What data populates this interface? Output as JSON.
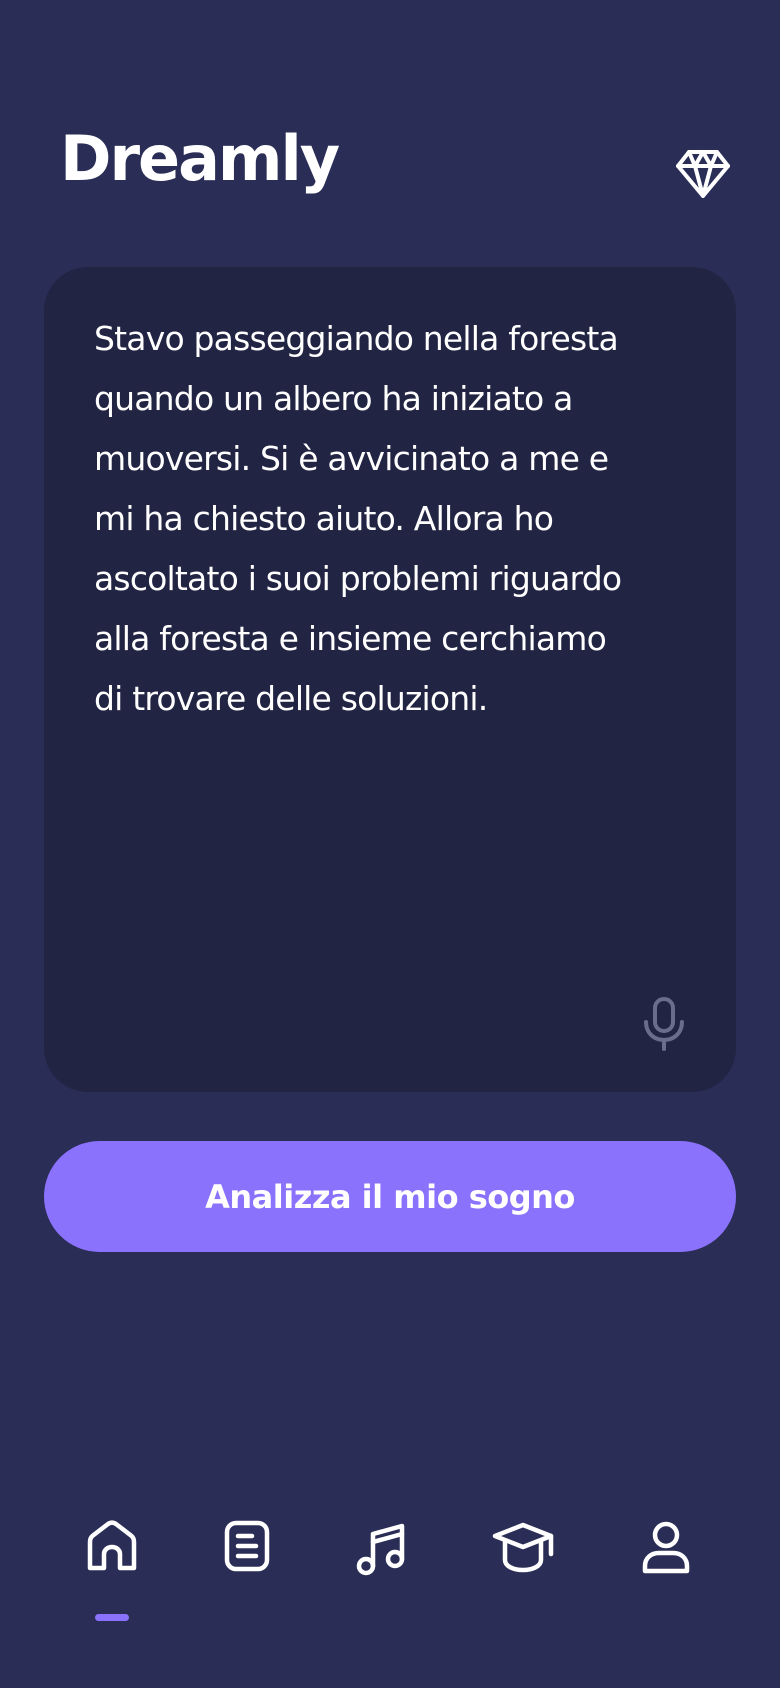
{
  "header": {
    "title": "Dreamly",
    "premium_icon": "diamond-icon"
  },
  "dream_input": {
    "text": "Stavo passeggiando nella foresta\nquando un albero ha iniziato a\nmuoversi. Si è avvicinato a me e\nmi ha chiesto aiuto. Allora ho\nascoltato i suoi problemi riguardo\nalla foresta e insieme cerchiamo\ndi trovare delle soluzioni.",
    "mic_icon": "microphone-icon"
  },
  "actions": {
    "analyze_label": "Analizza il mio sogno"
  },
  "nav": {
    "active": "home",
    "items": [
      {
        "id": "home",
        "icon": "home-icon"
      },
      {
        "id": "journal",
        "icon": "document-icon"
      },
      {
        "id": "music",
        "icon": "music-note-icon"
      },
      {
        "id": "learn",
        "icon": "graduation-cap-icon"
      },
      {
        "id": "profile",
        "icon": "user-icon"
      }
    ]
  },
  "colors": {
    "background": "#2a2d56",
    "card": "#222443",
    "accent": "#8b72fc",
    "muted_icon": "#6b6d8c"
  }
}
